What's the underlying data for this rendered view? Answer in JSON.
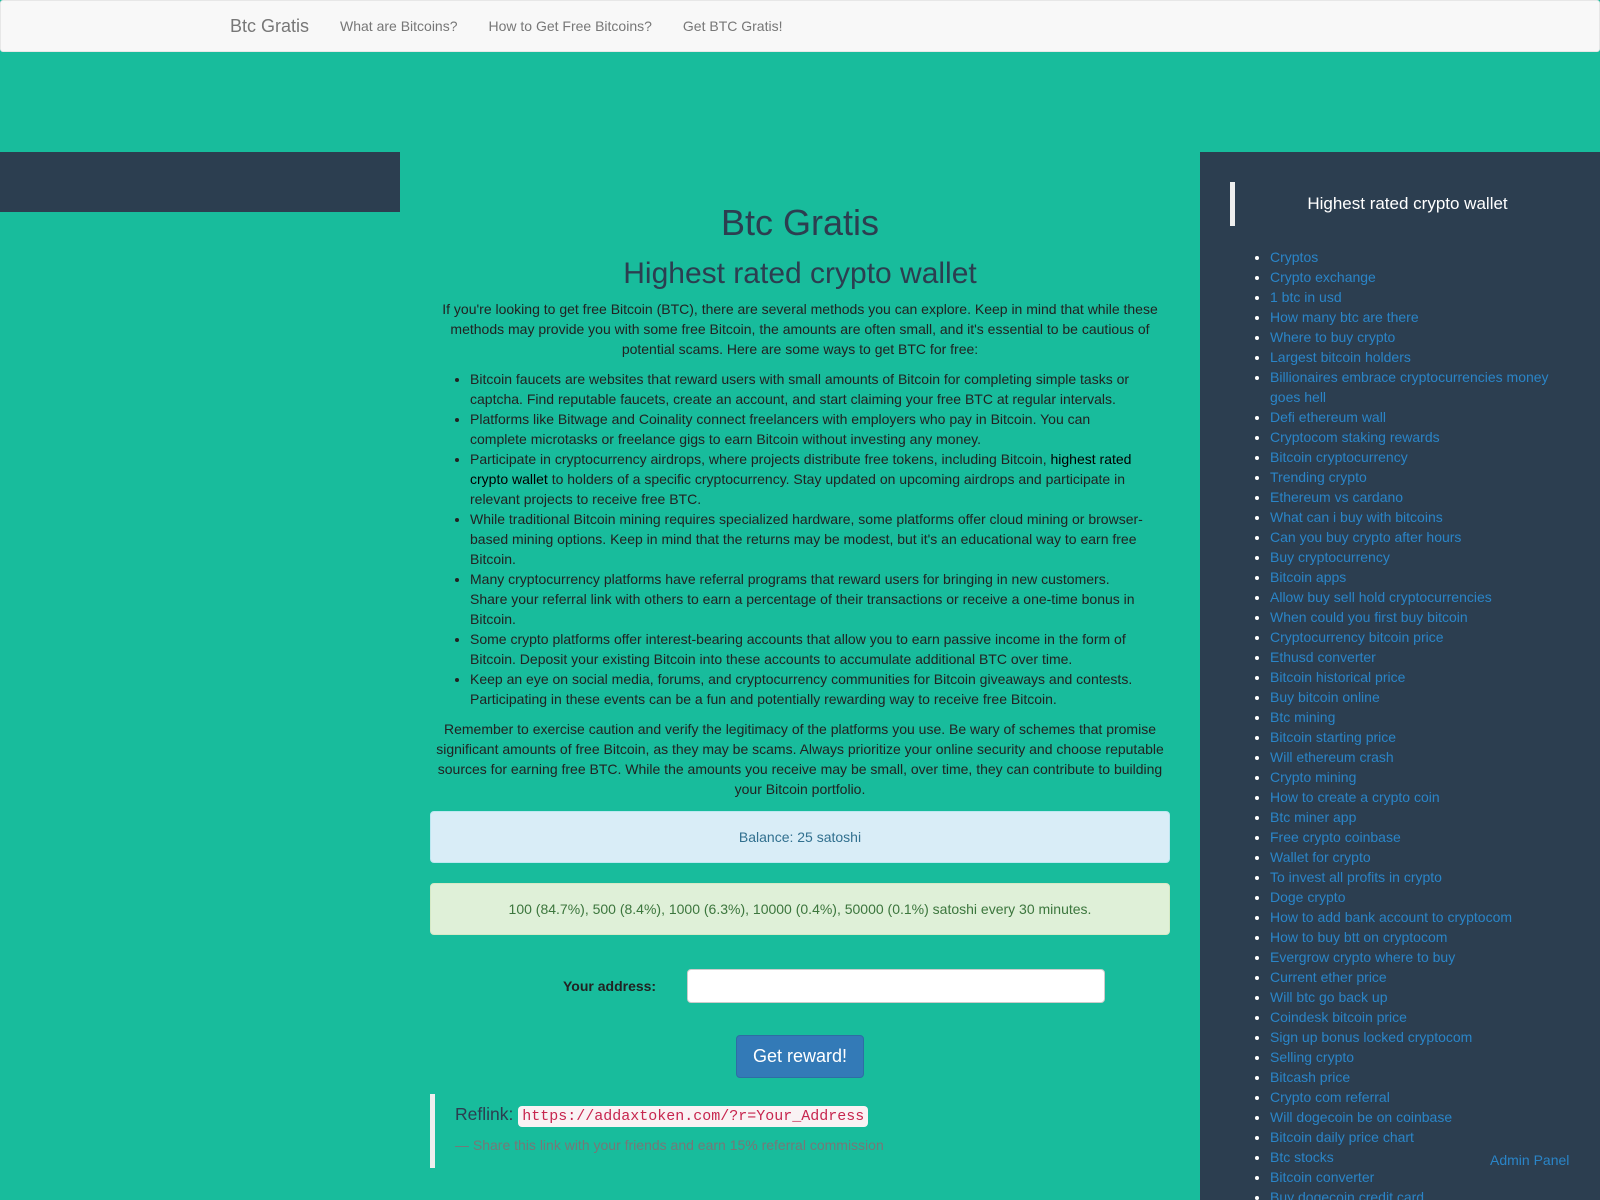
{
  "nav": {
    "brand": "Btc Gratis",
    "links": [
      "What are Bitcoins?",
      "How to Get Free Bitcoins?",
      "Get BTC Gratis!"
    ]
  },
  "main": {
    "site_title": "Btc Gratis",
    "heading": "Highest rated crypto wallet",
    "intro": "If you're looking to get free Bitcoin (BTC), there are several methods you can explore. Keep in mind that while these methods may provide you with some free Bitcoin, the amounts are often small, and it's essential to be cautious of potential scams. Here are some ways to get BTC for free:",
    "tips": [
      "Bitcoin faucets are websites that reward users with small amounts of Bitcoin for completing simple tasks or captcha. Find reputable faucets, create an account, and start claiming your free BTC at regular intervals.",
      "Platforms like Bitwage and Coinality connect freelancers with employers who pay in Bitcoin. You can complete microtasks or freelance gigs to earn Bitcoin without investing any money.",
      "",
      "While traditional Bitcoin mining requires specialized hardware, some platforms offer cloud mining or browser-based mining options. Keep in mind that the returns may be modest, but it's an educational way to earn free Bitcoin.",
      "Many cryptocurrency platforms have referral programs that reward users for bringing in new customers. Share your referral link with others to earn a percentage of their transactions or receive a one-time bonus in Bitcoin.",
      "Some crypto platforms offer interest-bearing accounts that allow you to earn passive income in the form of Bitcoin. Deposit your existing Bitcoin into these accounts to accumulate additional BTC over time.",
      "Keep an eye on social media, forums, and cryptocurrency communities for Bitcoin giveaways and contests. Participating in these events can be a fun and potentially rewarding way to receive free Bitcoin."
    ],
    "tip3_before": "Participate in cryptocurrency airdrops, where projects distribute free tokens, including Bitcoin, ",
    "tip3_highlight": "highest rated crypto wallet",
    "tip3_after": " to holders of a specific cryptocurrency. Stay updated on upcoming airdrops and participate in relevant projects to receive free BTC.",
    "closing": "Remember to exercise caution and verify the legitimacy of the platforms you use. Be wary of schemes that promise significant amounts of free Bitcoin, as they may be scams. Always prioritize your online security and choose reputable sources for earning free BTC. While the amounts you receive may be small, over time, they can contribute to building your Bitcoin portfolio.",
    "balance": "Balance: 25 satoshi",
    "rewards": "100 (84.7%), 500 (8.4%), 1000 (6.3%), 10000 (0.4%), 50000 (0.1%) satoshi every 30 minutes.",
    "address_label": "Your address:",
    "address_value": "",
    "button": "Get reward!",
    "reflink_label": "Reflink:",
    "reflink_url": "https://addaxtoken.com/?r=Your_Address",
    "reflink_note": "— Share this link with your friends and earn 15% referral commission"
  },
  "sidebar": {
    "title": "Highest rated crypto wallet",
    "links": [
      "Cryptos",
      "Crypto exchange",
      "1 btc in usd",
      "How many btc are there",
      "Where to buy crypto",
      "Largest bitcoin holders",
      "Billionaires embrace cryptocurrencies money goes hell",
      "Defi ethereum wall",
      "Cryptocom staking rewards",
      "Bitcoin cryptocurrency",
      "Trending crypto",
      "Ethereum vs cardano",
      "What can i buy with bitcoins",
      "Can you buy crypto after hours",
      "Buy cryptocurrency",
      "Bitcoin apps",
      "Allow buy sell hold cryptocurrencies",
      "When could you first buy bitcoin",
      "Cryptocurrency bitcoin price",
      "Ethusd converter",
      "Bitcoin historical price",
      "Buy bitcoin online",
      "Btc mining",
      "Bitcoin starting price",
      "Will ethereum crash",
      "Crypto mining",
      "How to create a crypto coin",
      "Btc miner app",
      "Free crypto coinbase",
      "Wallet for crypto",
      "To invest all profits in crypto",
      "Doge crypto",
      "How to add bank account to cryptocom",
      "How to buy btt on cryptocom",
      "Evergrow crypto where to buy",
      "Current ether price",
      "Will btc go back up",
      "Coindesk bitcoin price",
      "Sign up bonus locked cryptocom",
      "Selling crypto",
      "Bitcash price",
      "Crypto com referral",
      "Will dogecoin be on coinbase",
      "Bitcoin daily price chart",
      "Btc stocks",
      "Bitcoin converter",
      "Buy dogecoin credit card"
    ]
  },
  "admin": "Admin Panel",
  "colors": {
    "background": "#18bc9c",
    "dark": "#2c3e50",
    "link": "#2a85c8",
    "button": "#337ab7"
  }
}
